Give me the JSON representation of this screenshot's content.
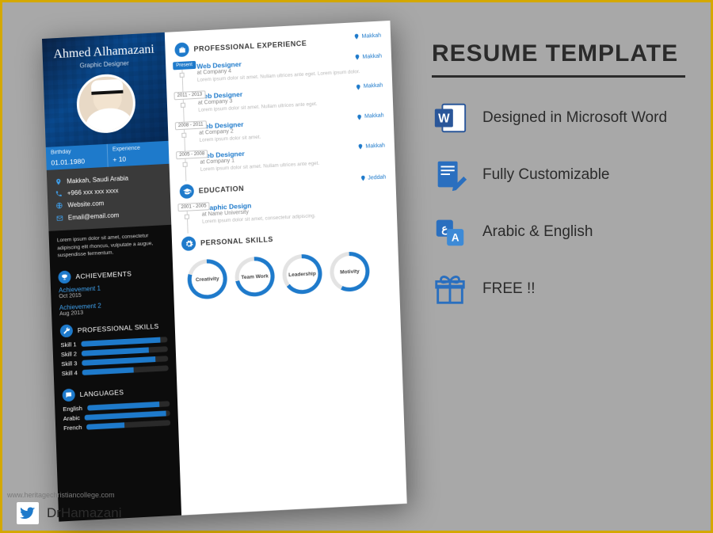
{
  "promo": {
    "title": "RESUME TEMPLATE",
    "features": [
      {
        "icon": "word",
        "text": "Designed in Microsoft Word"
      },
      {
        "icon": "edit",
        "text": "Fully Customizable"
      },
      {
        "icon": "lang",
        "text": "Arabic & English"
      },
      {
        "icon": "gift",
        "text": "FREE !!"
      }
    ],
    "twitter": "DrHamazani",
    "credit": "www.heritagechristiancollege.com"
  },
  "resume": {
    "name": "Ahmed Alhamazani",
    "role": "Graphic Designer",
    "birthday_label": "Birthday",
    "birthday": "01.01.1980",
    "experience_label": "Experience",
    "experience": "+ 10",
    "contacts": {
      "location": "Makkah, Saudi Arabia",
      "phone": "+966 xxx xxx xxxx",
      "website": "Website.com",
      "email": "Email@email.com"
    },
    "blurb": "Lorem ipsum dolor sit amet, consectetur adipiscing elit rhoncus, vulputate a augue, suspendisse fermentum.",
    "achievements": {
      "title": "ACHIEVEMENTS",
      "items": [
        {
          "t": "Achievement 1",
          "d": "Oct 2015"
        },
        {
          "t": "Achievement 2",
          "d": "Aug 2013"
        }
      ]
    },
    "proskills": {
      "title": "PROFESSIONAL SKILLS",
      "items": [
        {
          "name": "Skill 1",
          "p": 92
        },
        {
          "name": "Skill 2",
          "p": 78
        },
        {
          "name": "Skill 3",
          "p": 85
        },
        {
          "name": "Skill 4",
          "p": 60
        }
      ]
    },
    "languages": {
      "title": "LANGUAGES",
      "items": [
        {
          "name": "English",
          "p": 88
        },
        {
          "name": "Arabic",
          "p": 95
        },
        {
          "name": "French",
          "p": 45
        }
      ]
    },
    "experience_section": {
      "title": "PROFESSIONAL EXPERIENCE",
      "loc": "Makkah",
      "items": [
        {
          "period": "Present",
          "present": true,
          "title": "Web Designer",
          "company": "at Company 4",
          "loc": "Makkah",
          "desc": "Lorem ipsum dolor sit amet. Nullam ultrices ante eget. Lorem ipsum dolor."
        },
        {
          "period": "2011 - 2013",
          "title": "Web Designer",
          "company": "at Company 3",
          "loc": "Makkah",
          "desc": "Lorem ipsum dolor sit amet. Nullam ultrices ante eget."
        },
        {
          "period": "2008 - 2011",
          "title": "Web Designer",
          "company": "at Company 2",
          "loc": "Makkah",
          "desc": "Lorem ipsum dolor sit amet."
        },
        {
          "period": "2005 - 2008",
          "title": "Web Designer",
          "company": "at Company 1",
          "loc": "Makkah",
          "desc": "Lorem ipsum dolor sit amet. Nullam ultrices ante eget."
        }
      ]
    },
    "education": {
      "title": "EDUCATION",
      "loc": "Jeddah",
      "items": [
        {
          "period": "2001 - 2005",
          "title": "Graphic Design",
          "company": "at Name University",
          "desc": "Lorem ipsum dolor sit amet, consectetur adipiscing."
        }
      ]
    },
    "personal": {
      "title": "PERSONAL SKILLS",
      "items": [
        {
          "name": "Creativity",
          "p": 80
        },
        {
          "name": "Team Work",
          "p": 72
        },
        {
          "name": "Leadership",
          "p": 65
        },
        {
          "name": "Motivity",
          "p": 58
        }
      ]
    }
  }
}
